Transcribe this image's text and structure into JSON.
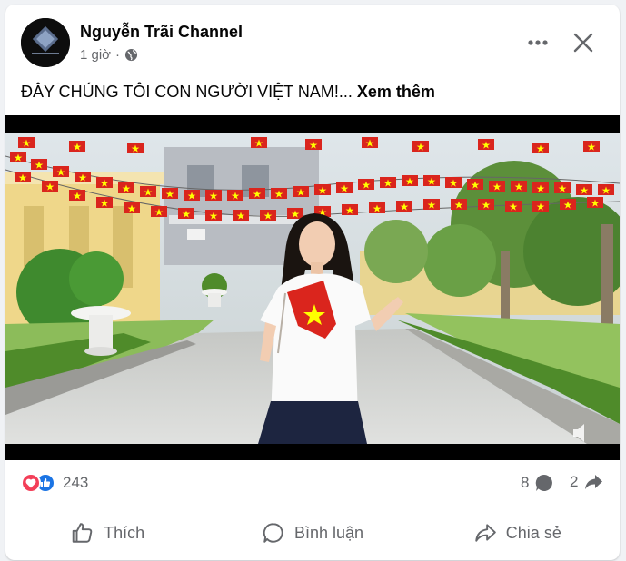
{
  "post": {
    "page_name": "Nguyễn Trãi Channel",
    "time": "1 giờ",
    "privacy_icon": "globe-icon",
    "caption": "ĐÂY CHÚNG TÔI CON NGƯỜI VIỆT NAM!...",
    "see_more": "Xem thêm"
  },
  "stats": {
    "reactions_count": "243",
    "reaction_types": [
      "love",
      "like"
    ],
    "comments_count": "8",
    "shares_count": "2"
  },
  "actions": {
    "like": "Thích",
    "comment": "Bình luận",
    "share": "Chia sẻ"
  },
  "colors": {
    "flag_red": "#da251d",
    "flag_star": "#ffff00",
    "love": "#f33e58",
    "like": "#1b74e4",
    "secondary_text": "#65676b"
  }
}
